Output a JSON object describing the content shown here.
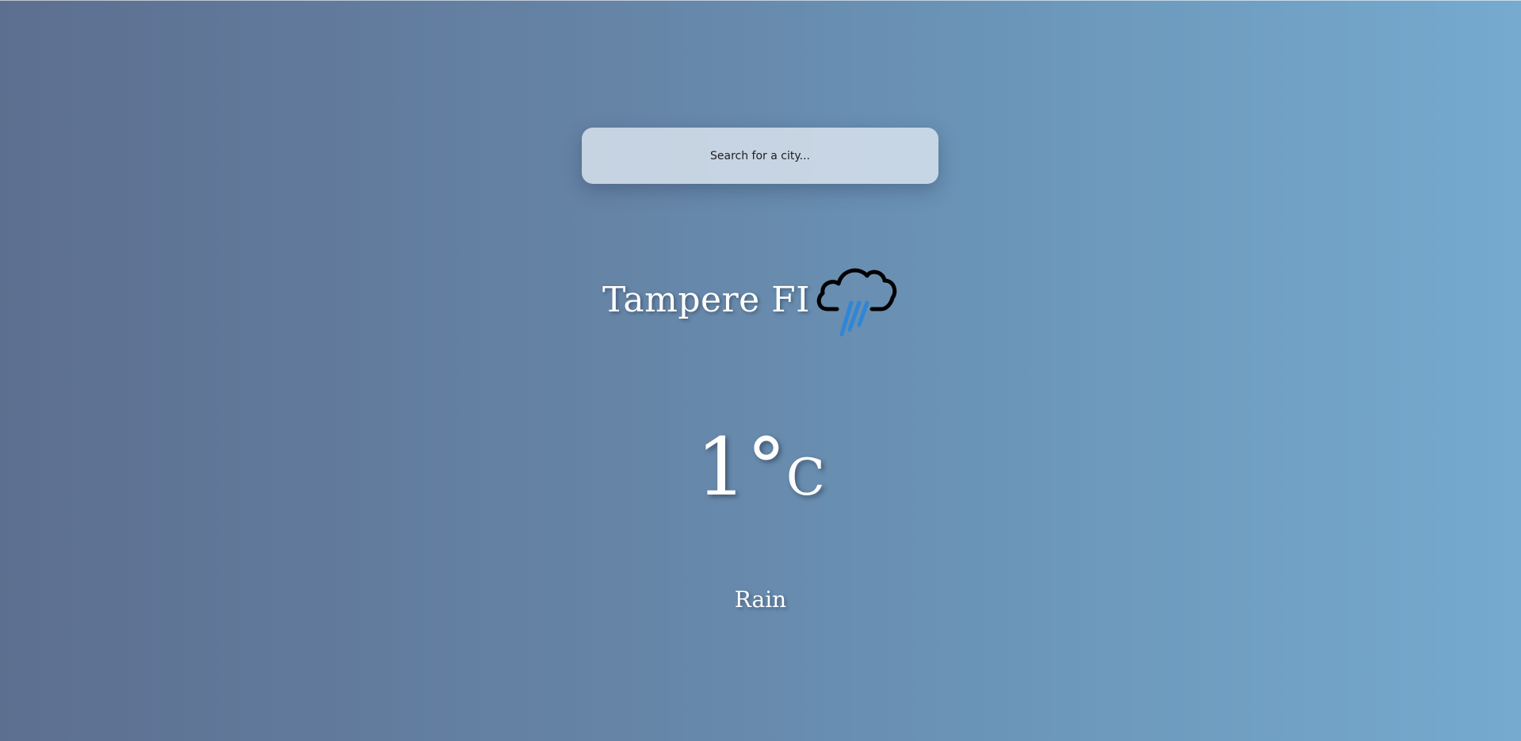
{
  "search": {
    "placeholder": "Search for a city..."
  },
  "weather": {
    "city": "Tampere FI",
    "temperature": "1",
    "degree_symbol": "°",
    "unit": "C",
    "condition": "Rain",
    "icon": "rain-cloud-icon"
  },
  "colors": {
    "background_left": "#5d6f90",
    "background_right": "#76aacf",
    "text": "#ffffff",
    "rain_drops": "#2f86d6",
    "cloud_outline": "#000000"
  }
}
